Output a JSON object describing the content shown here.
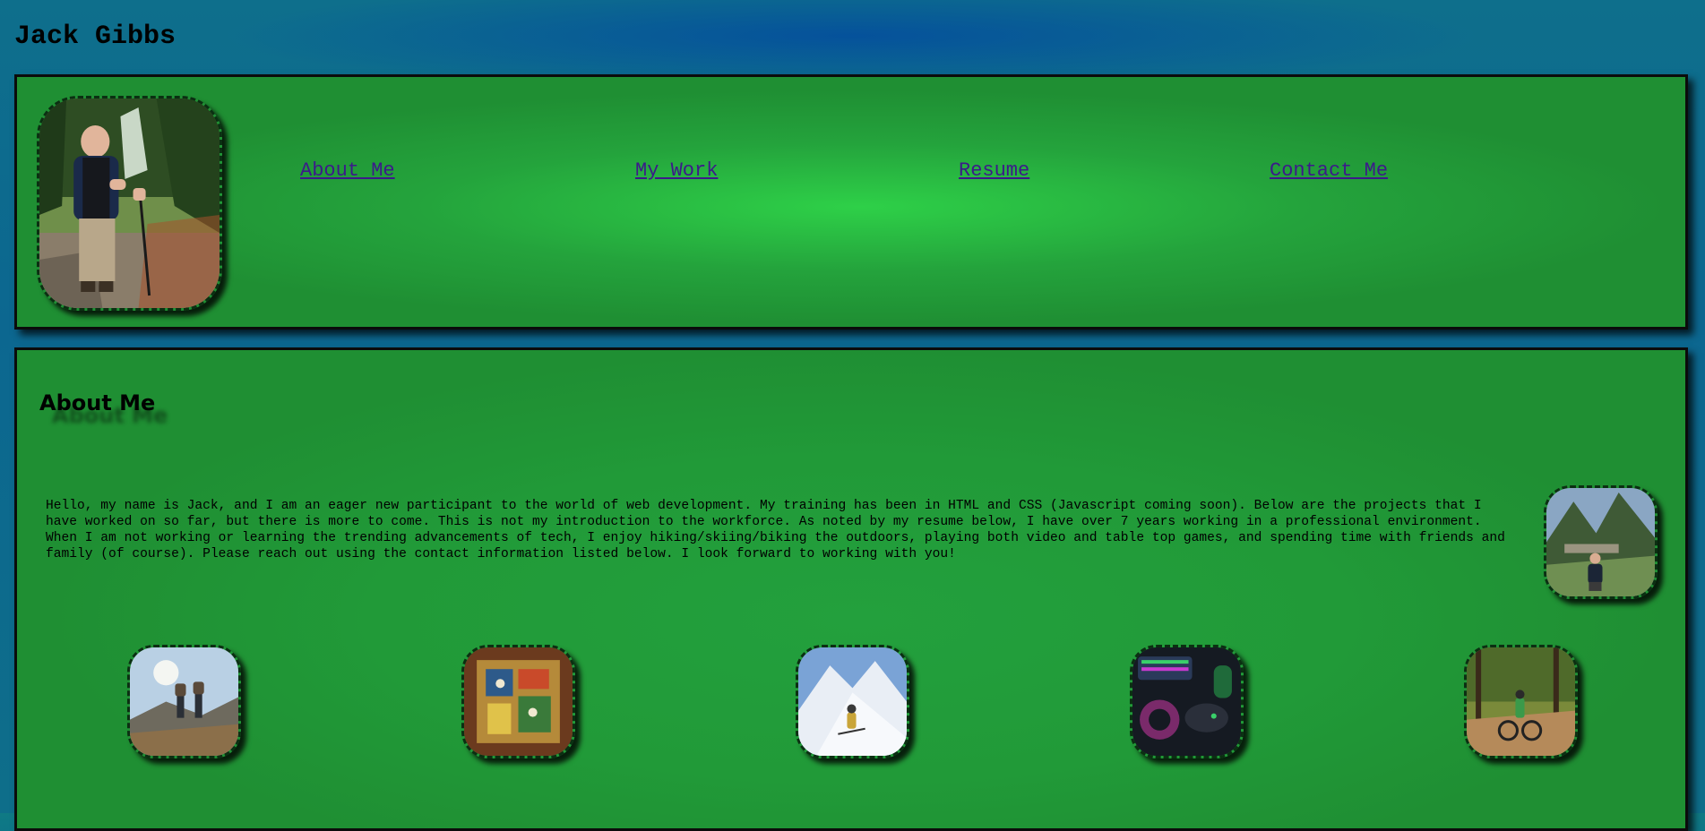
{
  "site": {
    "title": "Jack Gibbs"
  },
  "nav": {
    "links": [
      {
        "label": "About Me"
      },
      {
        "label": "My Work"
      },
      {
        "label": "Resume"
      },
      {
        "label": "Contact Me"
      }
    ],
    "link_color": "#3c1a8a"
  },
  "about": {
    "heading": "About Me",
    "paragraph": "Hello, my name is Jack, and I am an eager new participant to the world of web development. My training has been in HTML and CSS (Javascript coming soon). Below are the projects that I have worked on so far, but there is more to come. This is not my introduction to the workforce. As noted by my resume below, I have over 7 years working in a professional environment. When I am not working or learning the trending advancements of tech, I enjoy hiking/skiing/biking the outdoors, playing both video and table top games, and spending time with friends and family (of course). Please reach out using the contact information listed below. I look forward to working with you!"
  },
  "images": {
    "profile": "hiker-profile-photo",
    "about_side": "mountain-ruins-photo",
    "hobbies": [
      "hiking-photo",
      "board-game-photo",
      "skiing-photo",
      "gaming-setup-photo",
      "mountain-biking-photo"
    ]
  },
  "colors": {
    "panel_green": "#1f8f33",
    "panel_highlight": "#2ed048",
    "page_blue": "#0c6790",
    "border": "#0b0b0b",
    "photo_border": "#0b2f12"
  }
}
